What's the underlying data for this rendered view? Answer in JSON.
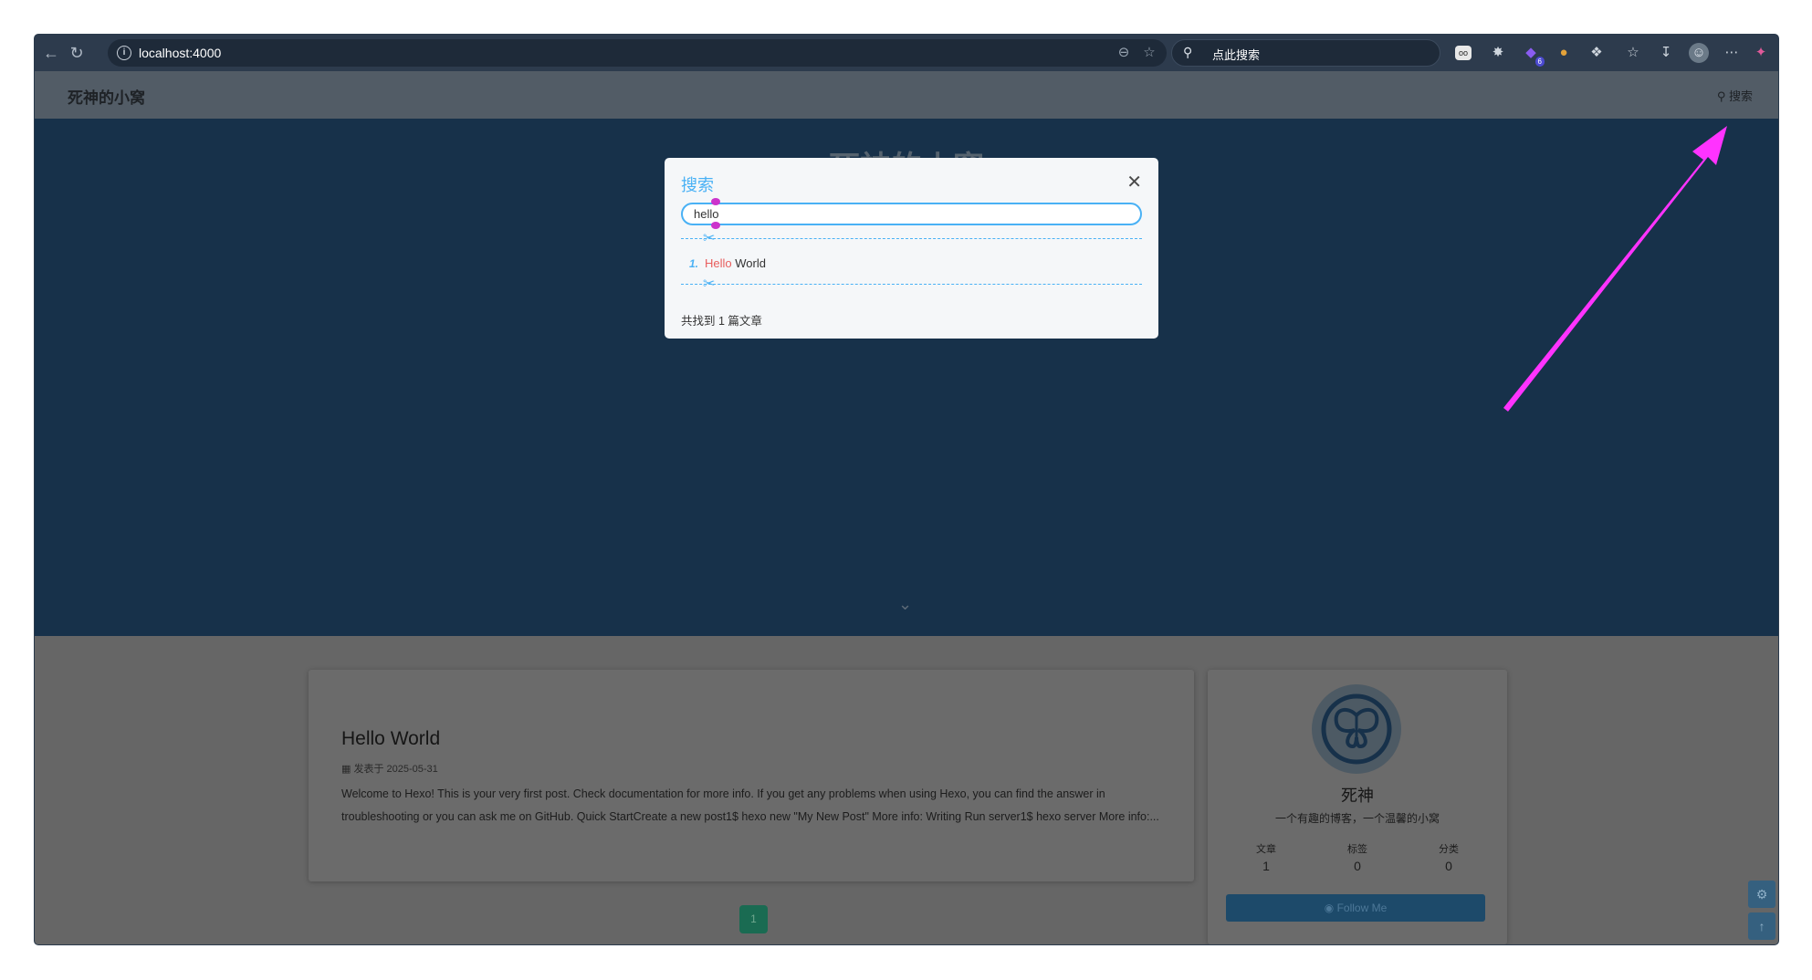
{
  "browser": {
    "url": "localhost:4000",
    "search_placeholder": "点此搜索",
    "ext_badge": "6"
  },
  "site": {
    "title": "死神的小窝",
    "search_label": "搜索",
    "hero_title": "死神的小窝"
  },
  "search_modal": {
    "title": "搜索",
    "query": "hello",
    "results": [
      {
        "index": "1.",
        "highlight": "Hello",
        "rest": " World"
      }
    ],
    "count_text": "共找到 1 篇文章"
  },
  "post": {
    "title": "Hello World",
    "date": "发表于 2025-05-31",
    "excerpt": "Welcome to Hexo! This is your very first post. Check documentation for more info. If you get any problems when using Hexo, you can find the answer in troubleshooting or you can ask me on GitHub. Quick StartCreate a new post1$ hexo new \"My New Post\" More info: Writing Run server1$ hexo server More info:..."
  },
  "pagination": {
    "current": "1"
  },
  "profile": {
    "name": "死神",
    "description": "一个有趣的博客，一个温馨的小窝",
    "stats": [
      {
        "label": "文章",
        "value": "1"
      },
      {
        "label": "标签",
        "value": "0"
      },
      {
        "label": "分类",
        "value": "0"
      }
    ],
    "follow_label": "Follow Me"
  },
  "colors": {
    "accent": "#49b1f5",
    "highlight": "#e85d5d",
    "annotation_arrow": "#ff33ff"
  }
}
